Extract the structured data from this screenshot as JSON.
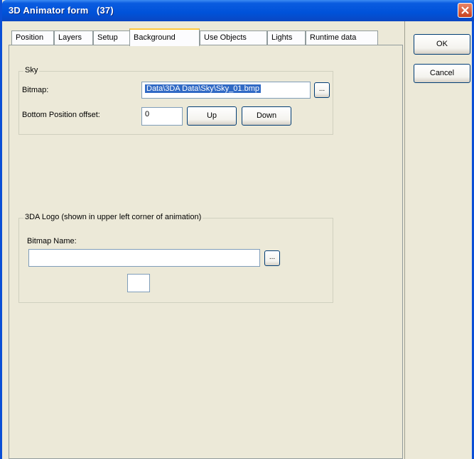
{
  "window": {
    "title": "3D Animator form   (37)"
  },
  "tabs": [
    {
      "label": "Position"
    },
    {
      "label": "Layers"
    },
    {
      "label": "Setup"
    },
    {
      "label": "Background"
    },
    {
      "label": "Use Objects"
    },
    {
      "label": "Lights"
    },
    {
      "label": "Runtime data"
    }
  ],
  "sky": {
    "legend": "Sky",
    "bitmap_label": "Bitmap:",
    "bitmap_value": "Data\\3DA Data\\Sky\\Sky_01.bmp",
    "browse_label": "...",
    "offset_label": "Bottom Position offset:",
    "offset_value": "0",
    "up_label": "Up",
    "down_label": "Down"
  },
  "logo": {
    "legend": "3DA Logo (shown in upper left corner of animation)",
    "bitmap_name_label": "Bitmap Name:",
    "bitmap_name_value": "",
    "browse_label": "..."
  },
  "actions": {
    "ok_label": "OK",
    "cancel_label": "Cancel"
  }
}
